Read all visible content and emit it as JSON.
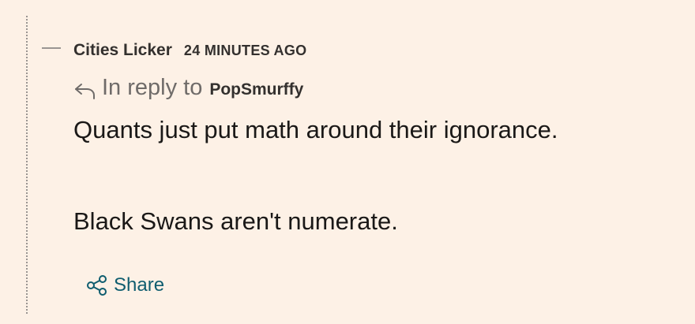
{
  "comment": {
    "author": "Cities Licker",
    "timestamp": "24 MINUTES AGO",
    "reply_prefix": "In reply to",
    "reply_to": "PopSmurffy",
    "paragraphs": [
      "Quants just put math around their ignorance.",
      "Black Swans aren't numerate."
    ]
  },
  "actions": {
    "share_label": "Share",
    "share_icon": "share-nodes-icon",
    "reply_icon": "reply-arrow-icon"
  },
  "colors": {
    "background": "#fdf1e6",
    "text": "#1a1817",
    "muted": "#6f6b69",
    "link_accent": "#0f5d6f"
  }
}
